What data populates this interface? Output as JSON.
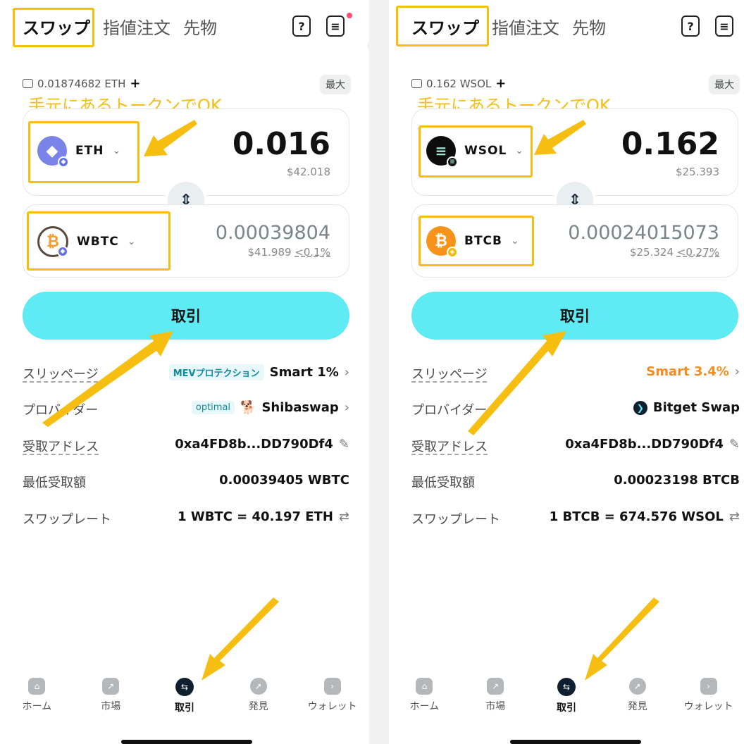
{
  "colors": {
    "accent": "#5eebf3",
    "highlight": "#f7be12",
    "warning": "#f48d20"
  },
  "panels": [
    {
      "tabs": [
        "スワップ",
        "指値注文",
        "先物"
      ],
      "balance": "0.01874682 ETH",
      "max_label": "最大",
      "note": "手元にあるトークンでOK",
      "from_token": {
        "symbol": "ETH",
        "amount": "0.016",
        "fiat": "$42.018",
        "icon": "ethereum-icon"
      },
      "to_token": {
        "symbol": "WBTC",
        "amount": "0.00039804",
        "fiat": "$41.989",
        "impact": "<0.1%",
        "icon": "bitcoin-icon"
      },
      "trade_label": "取引",
      "details": [
        {
          "label": "スリッページ",
          "tag": "MEVプロテクション",
          "value": "Smart 1%"
        },
        {
          "label": "プロバイダー",
          "tag": "optimal",
          "value": "Shibaswap"
        },
        {
          "label": "受取アドレス",
          "value": "0xa4FD8b...DD790Df4"
        },
        {
          "label": "最低受取額",
          "value": "0.00039405 WBTC"
        },
        {
          "label": "スワップレート",
          "value": "1 WBTC = 40.197 ETH"
        }
      ]
    },
    {
      "tabs": [
        "スワップ",
        "指値注文",
        "先物"
      ],
      "balance": "0.162 WSOL",
      "max_label": "最大",
      "note": "手元にあるトークンでOK",
      "from_token": {
        "symbol": "WSOL",
        "amount": "0.162",
        "fiat": "$25.393",
        "icon": "solana-icon"
      },
      "to_token": {
        "symbol": "BTCB",
        "amount": "0.00024015073",
        "fiat": "$25.324",
        "impact": "<0.27%",
        "icon": "bitcoin-icon"
      },
      "trade_label": "取引",
      "details": [
        {
          "label": "スリッページ",
          "value": "Smart 3.4%"
        },
        {
          "label": "プロバイダー",
          "value": "Bitget Swap"
        },
        {
          "label": "受取アドレス",
          "value": "0xa4FD8b...DD790Df4"
        },
        {
          "label": "最低受取額",
          "value": "0.00023198 BTCB"
        },
        {
          "label": "スワップレート",
          "value": "1 BTCB = 674.576 WSOL"
        }
      ]
    }
  ],
  "nav": [
    "ホーム",
    "市場",
    "取引",
    "発見",
    "ウォレット"
  ]
}
